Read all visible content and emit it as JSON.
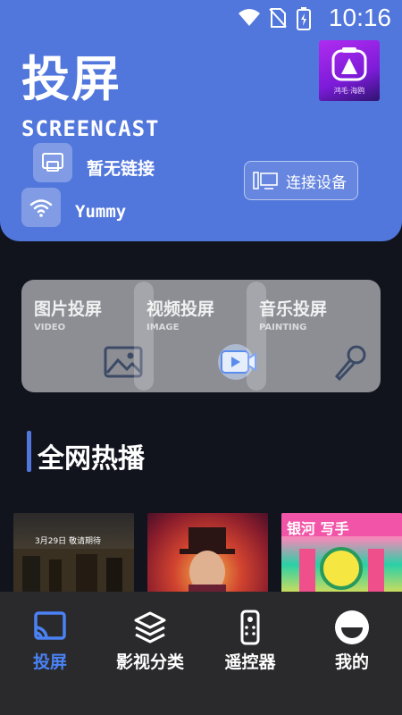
{
  "status_bar": {
    "time": "10:16"
  },
  "header": {
    "title": "投屏",
    "subtitle": "SCREENCAST",
    "logo_text": "鸿毛·海鸥",
    "connection_status": "暂无链接",
    "wifi_name": "Yummy",
    "connect_button_label": "连接设备"
  },
  "cast_cards": [
    {
      "title": "图片投屏",
      "subtitle": "VIDEO",
      "icon": "image-icon"
    },
    {
      "title": "视频投屏",
      "subtitle": "IMAGE",
      "icon": "video-icon"
    },
    {
      "title": "音乐投屏",
      "subtitle": "PAINTING",
      "icon": "microphone-icon"
    }
  ],
  "section": {
    "title": "全网热播"
  },
  "posters": [
    {
      "caption": "3月29日 敬请期待"
    },
    {
      "caption": ""
    },
    {
      "caption": "银河 写手"
    }
  ],
  "tabs": [
    {
      "label": "投屏",
      "icon": "cast-icon",
      "active": true
    },
    {
      "label": "影视分类",
      "icon": "layers-icon",
      "active": false
    },
    {
      "label": "遥控器",
      "icon": "remote-icon",
      "active": false
    },
    {
      "label": "我的",
      "icon": "profile-icon",
      "active": false
    }
  ],
  "colors": {
    "accent": "#5176dc",
    "active_tab": "#4a82f5",
    "background": "#11141d"
  }
}
